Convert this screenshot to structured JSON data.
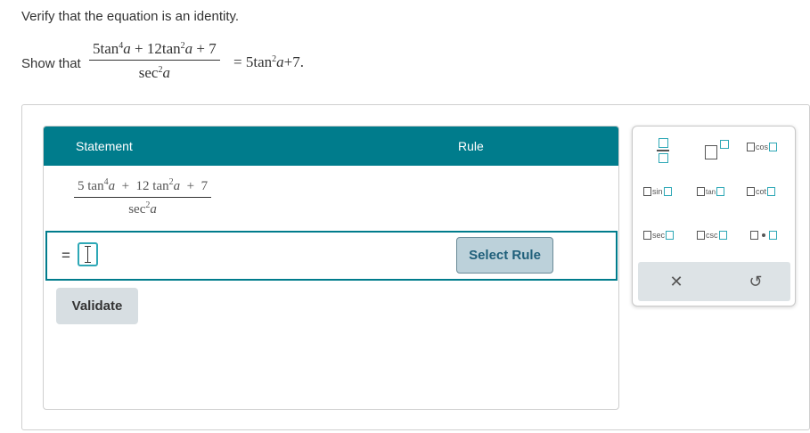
{
  "problem": {
    "instruction": "Verify that the equation is an identity.",
    "show_label": "Show that",
    "numerator": {
      "term1_coef": "5",
      "term1_func": "tan",
      "term1_exp": "4",
      "term1_var": "a",
      "plus1": "+",
      "term2_coef": "12",
      "term2_func": "tan",
      "term2_exp": "2",
      "term2_var": "a",
      "plus2": "+",
      "term3": "7"
    },
    "denominator": {
      "func": "sec",
      "exp": "2",
      "var": "a"
    },
    "rhs": {
      "eq": "=",
      "coef": "5",
      "func": "tan",
      "exp": "2",
      "var": "a",
      "rest": "+7."
    }
  },
  "table": {
    "header_statement": "Statement",
    "header_rule": "Rule",
    "row0": {
      "numerator": {
        "term1_coef": "5",
        "term1_func": "tan",
        "term1_exp": "4",
        "term1_var": "a",
        "plus1": "+",
        "term2_coef": "12",
        "term2_func": "tan",
        "term2_exp": "2",
        "term2_var": "a",
        "plus2": "+",
        "term3": "7"
      },
      "denominator": {
        "func": "sec",
        "exp": "2",
        "var": "a"
      }
    },
    "active_row": {
      "equals": "=",
      "select_rule_label": "Select Rule"
    }
  },
  "validate_label": "Validate",
  "keypad": {
    "cos": "cos",
    "sin": "sin",
    "tan": "tan",
    "cot": "cot",
    "sec": "sec",
    "csc": "csc",
    "clear_symbol": "✕",
    "undo_symbol": "↺",
    "icons": [
      "fraction-icon",
      "exponent-icon",
      "multiply-dot-icon",
      "clear-icon",
      "undo-icon"
    ]
  },
  "colors": {
    "header": "#007c8c",
    "accent_box": "#2ea8b6",
    "button": "#bcd1da"
  }
}
